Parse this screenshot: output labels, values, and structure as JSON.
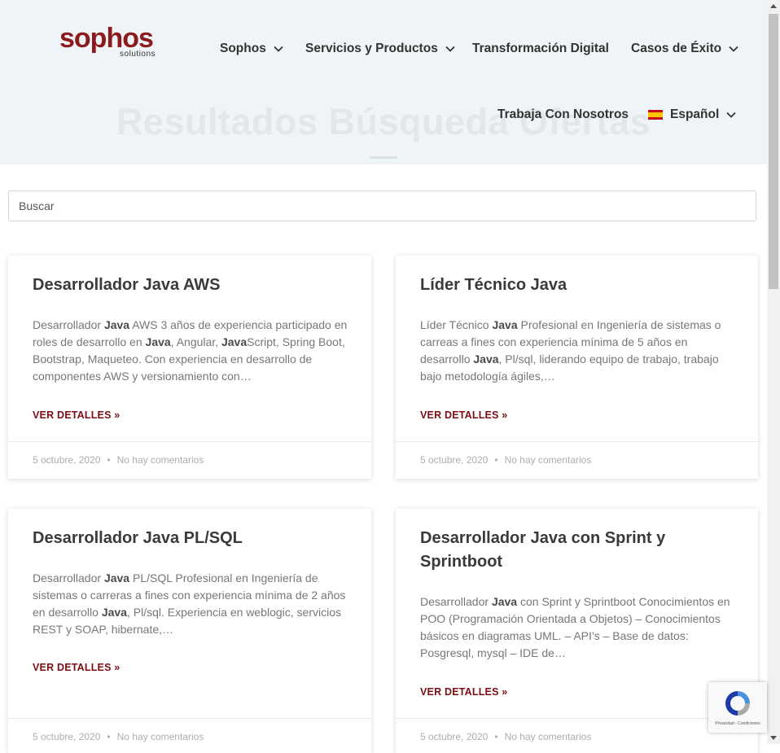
{
  "header": {
    "logo": {
      "name": "sophos",
      "tagline": "solutions"
    },
    "nav": [
      {
        "label": "Sophos"
      },
      {
        "label": "Servicios y Productos"
      },
      {
        "label": "Transformación Digital"
      },
      {
        "label": "Casos de Éxito"
      },
      {
        "label": "Trabaja Con Nosotros"
      },
      {
        "label": "Español"
      }
    ]
  },
  "hero": {
    "title": "Resultados Búsqueda Ofertas"
  },
  "search": {
    "placeholder": "Buscar",
    "value": ""
  },
  "posts": [
    {
      "title": "Desarrollador Java AWS",
      "excerpt": [
        {
          "text": "Desarrollador "
        },
        {
          "text": "Java",
          "bold": true
        },
        {
          "text": " AWS 3 años de experiencia participado en roles de desarrollo en "
        },
        {
          "text": "Java",
          "bold": true
        },
        {
          "text": ", Angular, "
        },
        {
          "text": "Java",
          "bold": true
        },
        {
          "text": "Script, Spring Boot, Bootstrap, Maqueteo. Con experiencia en desarrollo de componentes AWS y versionamiento con…"
        }
      ],
      "link": "VER DETALLES »",
      "date": "5 octubre, 2020",
      "comments": "No hay comentarios"
    },
    {
      "title": "Líder Técnico Java",
      "excerpt": [
        {
          "text": "Líder Técnico "
        },
        {
          "text": "Java",
          "bold": true
        },
        {
          "text": " Profesional en Ingeniería de sistemas o carreas a fines con experiencia mínima de 5 años en desarrollo "
        },
        {
          "text": "Java",
          "bold": true
        },
        {
          "text": ", Pl/sql, liderando equipo de trabajo, trabajo bajo metodología ágiles,…"
        }
      ],
      "link": "VER DETALLES »",
      "date": "5 octubre, 2020",
      "comments": "No hay comentarios"
    },
    {
      "title": "Desarrollador Java PL/SQL",
      "excerpt": [
        {
          "text": "Desarrollador "
        },
        {
          "text": "Java",
          "bold": true
        },
        {
          "text": " PL/SQL Profesional en Ingeniería de sistemas o carreras a fines con experiencia mínima de 2 años en desarrollo "
        },
        {
          "text": "Java",
          "bold": true
        },
        {
          "text": ", Pl/sql. Experiencia en weblogic, servicios REST y SOAP, hibernate,…"
        }
      ],
      "link": "VER DETALLES »",
      "date": "5 octubre, 2020",
      "comments": "No hay comentarios"
    },
    {
      "title": "Desarrollador Java con Sprint y Sprintboot",
      "excerpt": [
        {
          "text": "Desarrollador "
        },
        {
          "text": "Java",
          "bold": true
        },
        {
          "text": " con Sprint y Sprintboot Conocimientos en POO (Programación Orientada a Objetos) – Conocimientos básicos en diagramas UML. – API’s – Base de datos: Posgresql, mysql – IDE de…"
        }
      ],
      "link": "VER DETALLES »",
      "date": "5 octubre, 2020",
      "comments": "No hay comentarios"
    }
  ],
  "recaptcha": {
    "text": "Privacidad - Condiciones"
  }
}
